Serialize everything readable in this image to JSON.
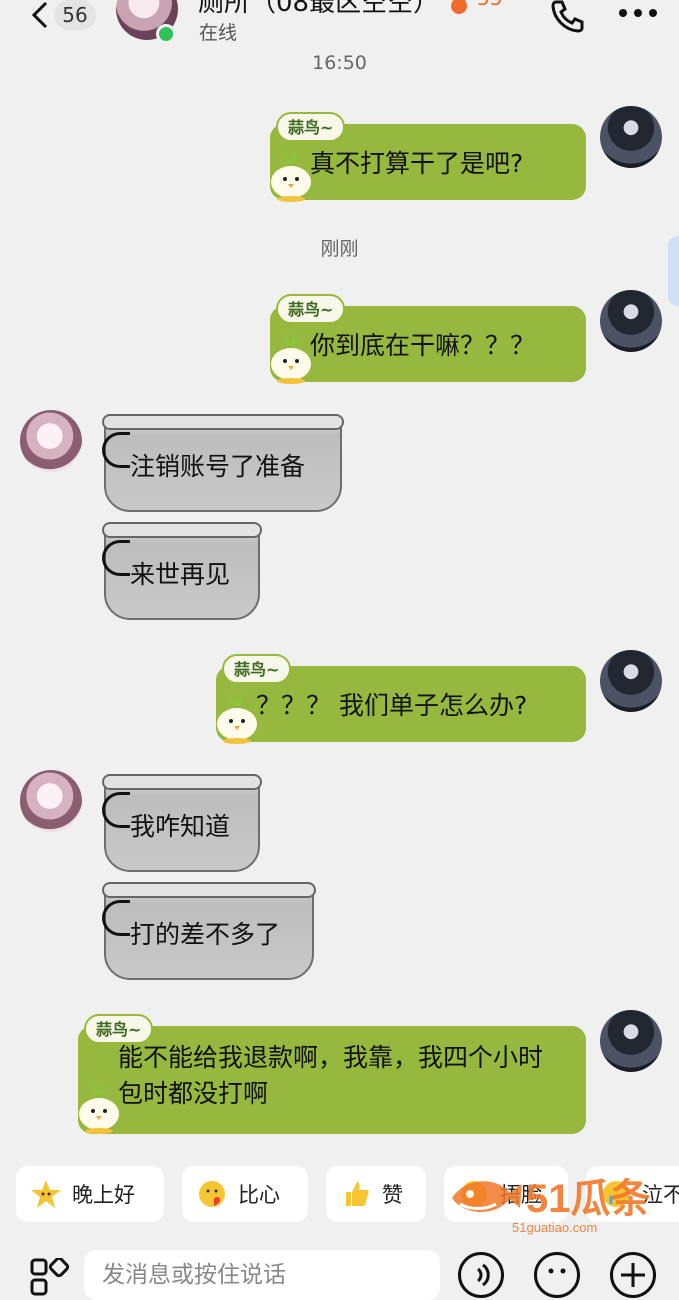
{
  "header": {
    "unread_count": "56",
    "title": "厕所（08最区空空）",
    "fire_count": "55",
    "status": "在线"
  },
  "messages": [
    {
      "type": "time",
      "text": "16:50"
    },
    {
      "type": "sent",
      "tag": "蒜鸟~",
      "text": "真不打算干了是吧?"
    },
    {
      "type": "time",
      "text": "刚刚"
    },
    {
      "type": "sent",
      "tag": "蒜鸟~",
      "text": "你到底在干嘛？？？"
    },
    {
      "type": "received",
      "text": "注销账号了准备"
    },
    {
      "type": "received",
      "text": "来世再见"
    },
    {
      "type": "sent",
      "tag": "蒜鸟~",
      "text": "？？？ 我们单子怎么办?"
    },
    {
      "type": "received",
      "text": "我咋知道"
    },
    {
      "type": "received",
      "text": "打的差不多了"
    },
    {
      "type": "sent",
      "tag": "蒜鸟~",
      "text": "能不能给我退款啊，我靠，我四个小时包时都没打啊"
    }
  ],
  "quick_replies": [
    {
      "icon": "star-face-icon",
      "label": "晚上好"
    },
    {
      "icon": "heart-face-icon",
      "label": "比心"
    },
    {
      "icon": "thumbs-up-icon",
      "label": "赞"
    },
    {
      "icon": "face-icon",
      "label": "捂脸"
    },
    {
      "icon": "crying-face-icon",
      "label": "泣不"
    }
  ],
  "input": {
    "placeholder": "发消息或按住说话"
  },
  "watermark": {
    "brand": "51瓜条",
    "url": "51guatiao.com"
  },
  "colors": {
    "sent_bubble": "#96b83e",
    "background": "#f0f0f0",
    "online": "#2fc25b",
    "fire": "#f36b2c"
  }
}
